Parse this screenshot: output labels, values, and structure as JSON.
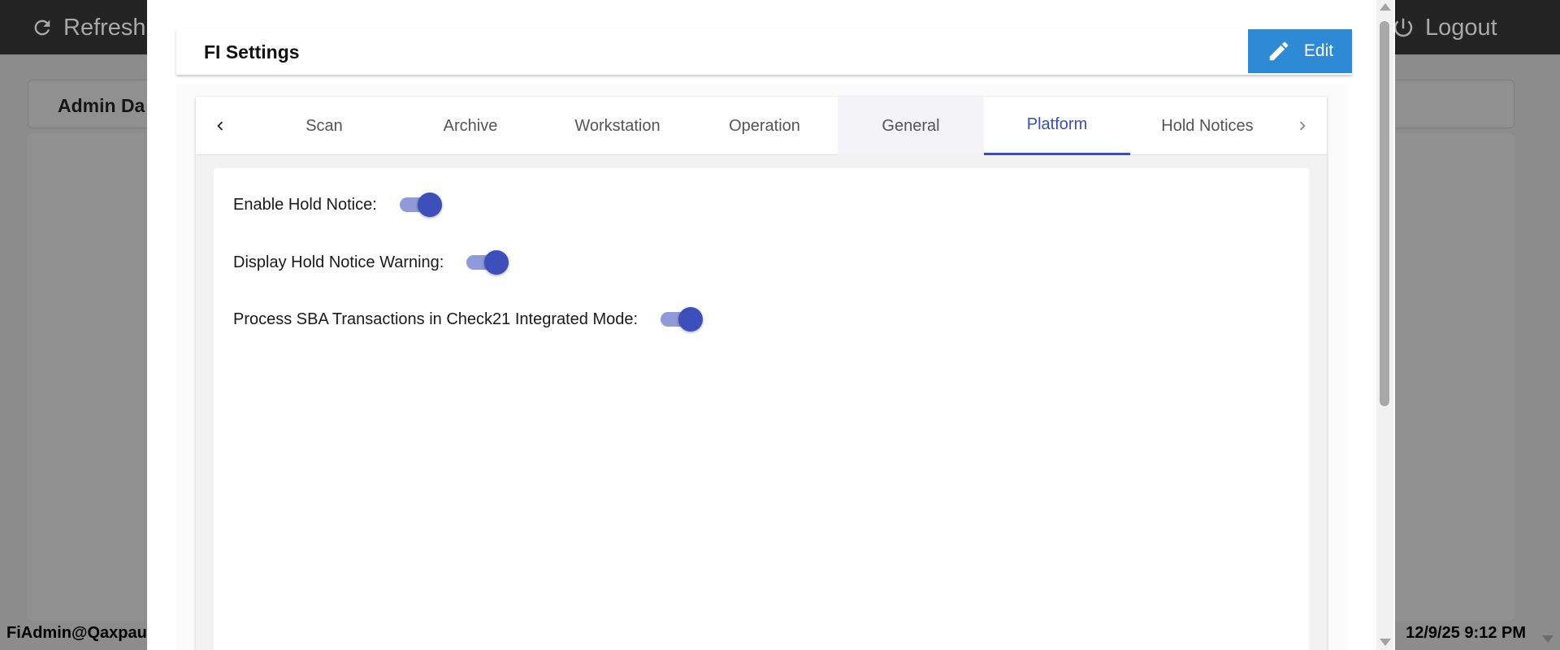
{
  "background": {
    "refresh_label": "Refresh",
    "logout_label": "Logout",
    "panel_title": "Admin Da",
    "status_user": "FiAdmin@Qaxpaut",
    "status_time": "12/9/25 9:12 PM"
  },
  "modal": {
    "title": "FI Settings",
    "edit_label": "Edit"
  },
  "tabs": [
    {
      "label": "Scan"
    },
    {
      "label": "Archive"
    },
    {
      "label": "Workstation"
    },
    {
      "label": "Operation"
    },
    {
      "label": "General"
    },
    {
      "label": "Platform"
    },
    {
      "label": "Hold Notices"
    }
  ],
  "active_tab": "Platform",
  "settings": [
    {
      "label": "Enable Hold Notice:",
      "enabled": true
    },
    {
      "label": "Display Hold Notice Warning:",
      "enabled": true
    },
    {
      "label": "Process SBA Transactions in Check21 Integrated Mode:",
      "enabled": true
    }
  ],
  "colors": {
    "accent": "#3a4fb5",
    "edit_button": "#2f8ad6",
    "toggle_track": "#8f9ad8",
    "toggle_thumb": "#3d4fbb"
  },
  "icons": {
    "refresh": "refresh-icon",
    "logout": "power-icon",
    "edit": "pencil-icon",
    "tab_prev": "chevron-left-icon",
    "tab_next": "chevron-right-icon"
  }
}
